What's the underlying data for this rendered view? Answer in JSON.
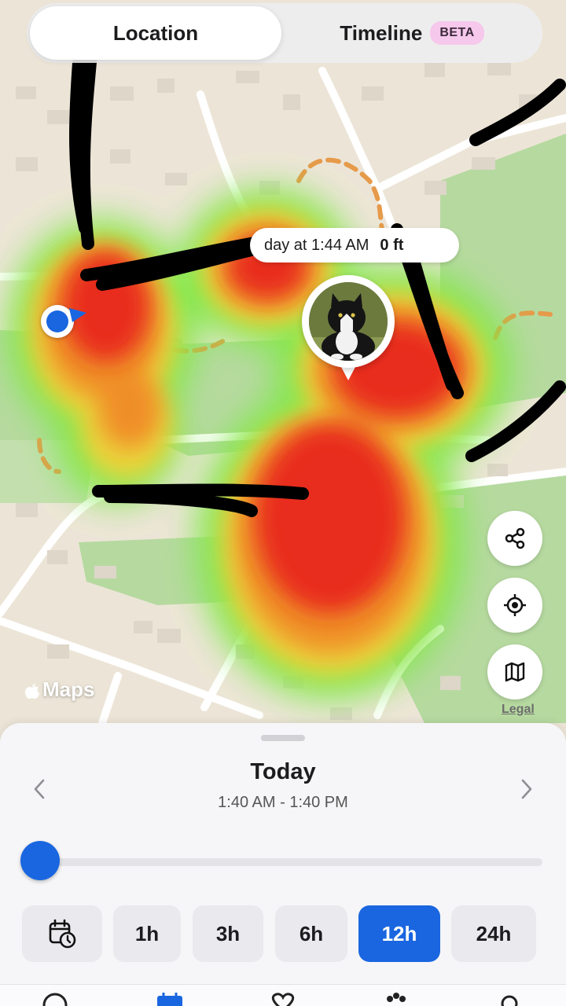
{
  "tabs": {
    "location": "Location",
    "timeline": "Timeline",
    "beta_badge": "BETA",
    "active": "location"
  },
  "map": {
    "tooltip_time": "day at 1:44 AM",
    "tooltip_distance": "0 ft",
    "pet_photo": "tuxedo-cat",
    "attribution": "Maps",
    "legal": "Legal",
    "buttons": [
      "share-icon",
      "locate-icon",
      "map-layers-icon"
    ],
    "colors": {
      "heat_core": "#e8221f",
      "heat_mid": "#f6a623",
      "heat_edge": "#7fe84a",
      "user_dot": "#1a66e0"
    }
  },
  "sheet": {
    "title": "Today",
    "range": "1:40 AM - 1:40 PM",
    "slider_position": 0,
    "range_buttons": [
      {
        "label": "1h"
      },
      {
        "label": "3h"
      },
      {
        "label": "6h"
      },
      {
        "label": "12h"
      },
      {
        "label": "24h"
      }
    ],
    "selected_range": "12h",
    "accent": "#1a66e0"
  }
}
